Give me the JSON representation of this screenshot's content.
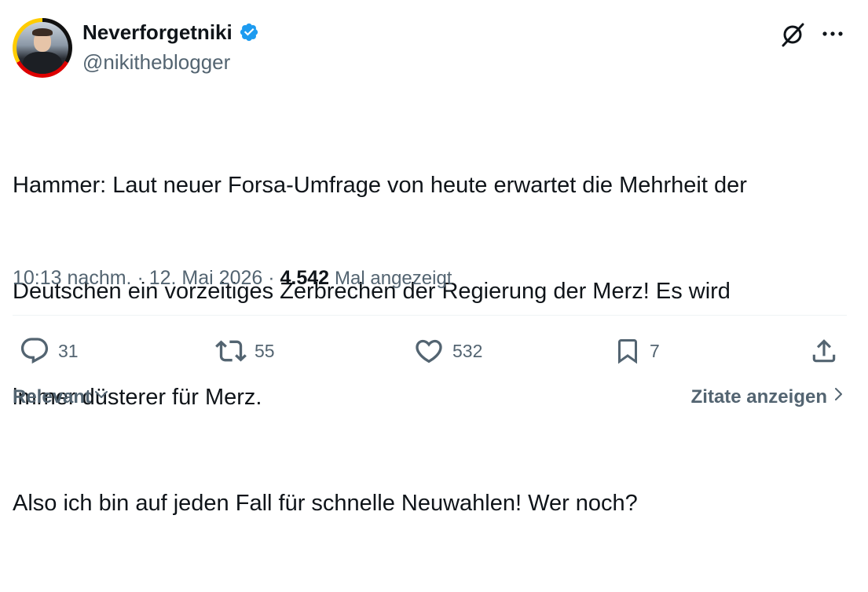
{
  "author": {
    "display_name": "Neverforgetniki",
    "handle": "@nikitheblogger",
    "verified": true
  },
  "tweet": {
    "lines": [
      "Hammer: Laut neuer Forsa-Umfrage von heute erwartet die Mehrheit der",
      "Deutschen ein vorzeitiges Zerbrechen der Regierung der Merz! Es wird",
      "immer düsterer für Merz.",
      "Also ich bin auf jeden Fall für schnelle Neuwahlen! Wer noch?"
    ]
  },
  "meta": {
    "time": "10:13 nachm.",
    "separator": "·",
    "date": "12. Mai 2026",
    "views_count": "4.542",
    "views_label": "Mal angezeigt"
  },
  "actions": {
    "replies": "31",
    "reposts": "55",
    "likes": "532",
    "bookmarks": "7"
  },
  "footer": {
    "sort_label": "Relevant",
    "quotes_label": "Zitate anzeigen"
  },
  "colors": {
    "text_primary": "#0f1419",
    "text_secondary": "#536471",
    "verified_blue": "#1d9bf0",
    "divider": "#eff3f4"
  },
  "icons": {
    "verified": "verified-badge-icon",
    "grok": "grok-icon",
    "more": "more-icon",
    "reply": "reply-icon",
    "repost": "repost-icon",
    "like": "like-icon",
    "bookmark": "bookmark-icon",
    "share": "share-icon",
    "sort_chevron": "chevron-down-icon",
    "quotes_chevron": "chevron-right-icon"
  }
}
